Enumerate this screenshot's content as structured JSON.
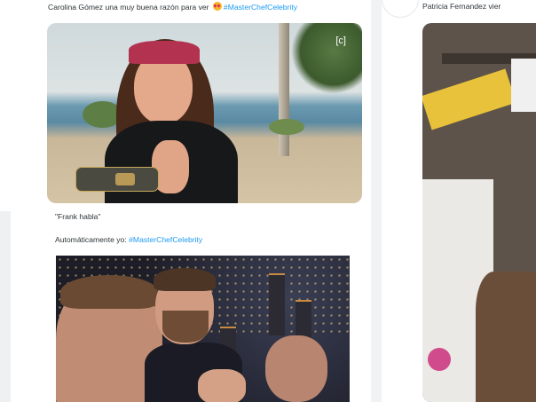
{
  "tweet_1": {
    "text_before": "Carolina Gómez una muy buena razón para ver",
    "emoji": "smiling-face-with-heart-eyes",
    "hashtag": "#MasterChefCelebrity",
    "image": {
      "channel_logo": "[c]"
    }
  },
  "tweet_2": {
    "line_1": "\"Frank habla\"",
    "line_2_text": "Automáticamente yo:",
    "hashtag": "#MasterChefCelebrity"
  },
  "tweet_3": {
    "text": "Patricia Fernandez vier"
  },
  "colors": {
    "hashtag": "#1d9bf0",
    "text": "#2d3338",
    "background": "#eef0f2"
  }
}
